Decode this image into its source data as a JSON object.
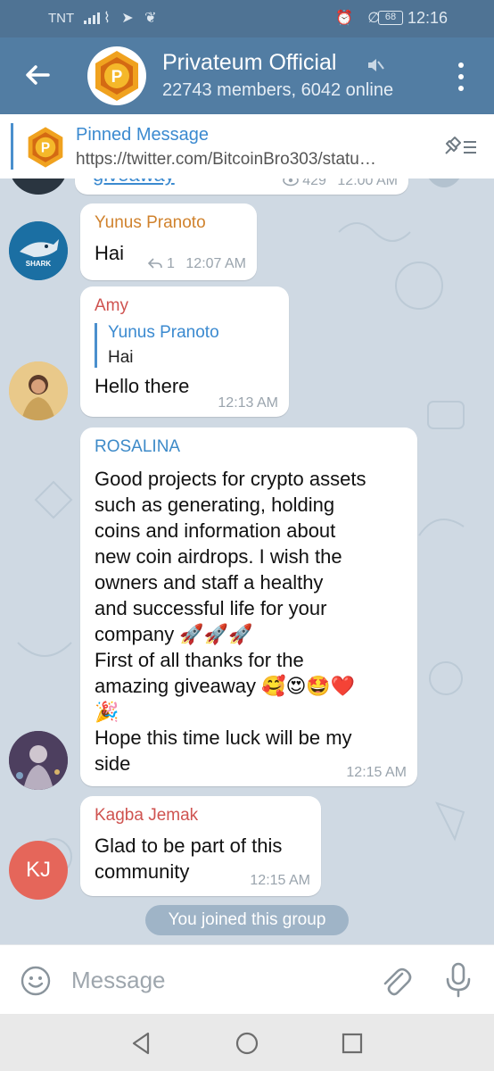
{
  "status_bar": {
    "carrier": "TNT",
    "left_icons": "⌇ ➤ ❦",
    "right_icons": "⏰ ∅",
    "battery": "68",
    "time": "12:16"
  },
  "header": {
    "title": "Privateum Official",
    "subtitle": "22743 members, 6042 online",
    "logo_letter": "P"
  },
  "pinned": {
    "title": "Pinned Message",
    "text": "https://twitter.com/BitcoinBro303/statu…"
  },
  "messages": [
    {
      "sender": "",
      "text": "giveaway",
      "views": "429",
      "time": "12:00 AM"
    },
    {
      "sender": "Yunus Pranoto",
      "sender_color": "#d0822d",
      "text": "Hai",
      "reply_count": "1",
      "time": "12:07 AM",
      "avatar_label": "SHARK"
    },
    {
      "sender": "Amy",
      "sender_color": "#cf5350",
      "quote_name": "Yunus Pranoto",
      "quote_text": "Hai",
      "text": "Hello there",
      "time": "12:13 AM"
    },
    {
      "sender": "ROSALINA",
      "sender_color": "#3d8ac8",
      "lines": [
        "Good projects for crypto assets",
        "such as generating, holding",
        "coins and information about",
        "new coin airdrops. I wish the",
        "owners and staff a healthy",
        "and successful life for your",
        "company 🚀🚀🚀",
        "First of all thanks for the",
        "amazing giveaway 🥰😍🤩❤️",
        "🎉",
        "Hope this time luck will be my",
        "side"
      ],
      "time": "12:15 AM"
    },
    {
      "sender": "Kagba Jemak",
      "sender_color": "#cf5350",
      "lines": [
        "Glad to be part of this",
        "community"
      ],
      "time": "12:15 AM",
      "avatar_initials": "KJ",
      "avatar_color": "#e5665a"
    }
  ],
  "service_message": "You joined this group",
  "input": {
    "placeholder": "Message"
  },
  "colors": {
    "header": "#527da3",
    "status_bar": "#4f7394",
    "accent": "#3b8ad0",
    "chat_background": "#cfd9e3"
  }
}
